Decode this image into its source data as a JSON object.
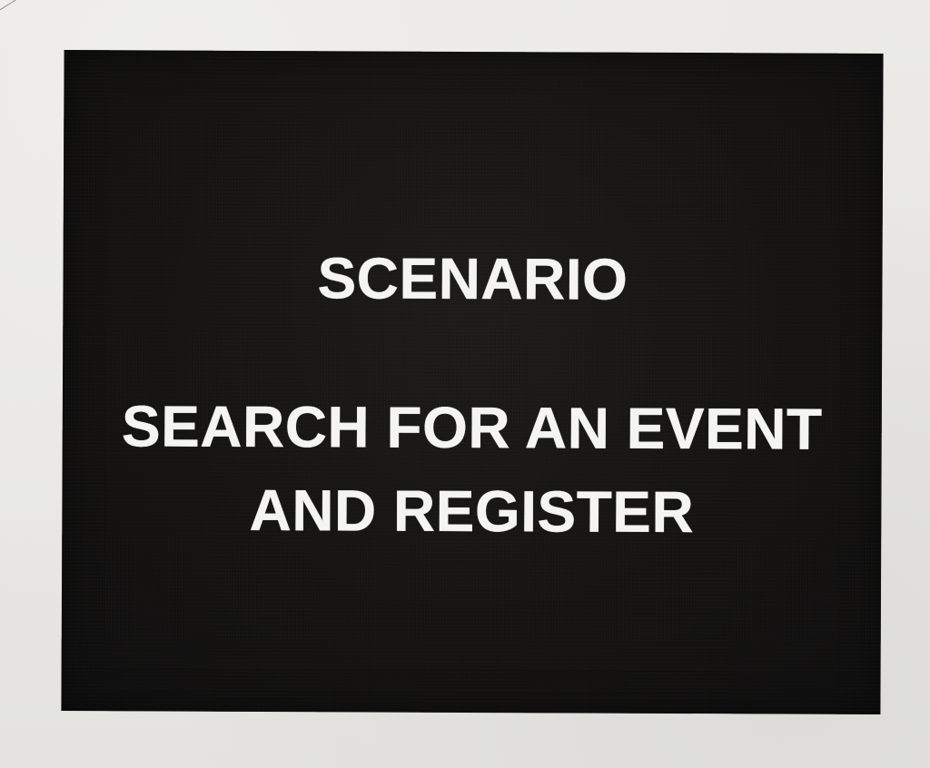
{
  "sign": {
    "label": "SCENARIO",
    "task_lines": [
      "SEARCH FOR AN EVENT",
      "AND REGISTER"
    ]
  },
  "colors": {
    "background": "#e8e7e4",
    "panel": "#141312",
    "text": "#f4f4f2"
  }
}
